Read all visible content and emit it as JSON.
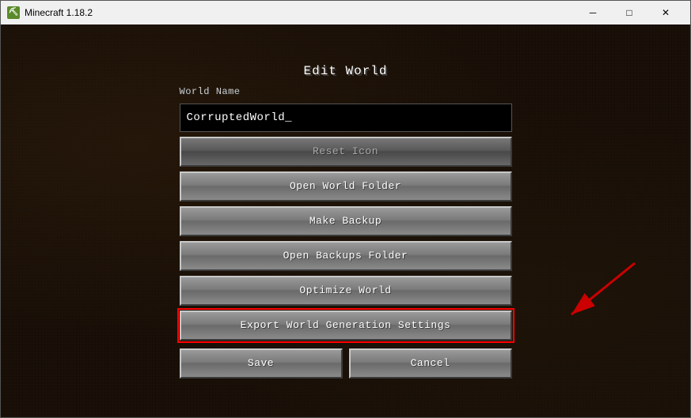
{
  "window": {
    "title": "Minecraft 1.18.2",
    "icon_label": "M",
    "controls": {
      "minimize": "─",
      "maximize": "□",
      "close": "✕"
    }
  },
  "dialog": {
    "title": "Edit World",
    "world_name_label": "World Name",
    "world_name_value": "CorruptedWorld_",
    "world_name_placeholder": "World Name",
    "buttons": {
      "reset_icon": "Reset Icon",
      "open_world_folder": "Open World Folder",
      "make_backup": "Make Backup",
      "open_backups_folder": "Open Backups Folder",
      "optimize_world": "Optimize World",
      "export_world_generation_settings": "Export World Generation Settings",
      "save": "Save",
      "cancel": "Cancel"
    }
  }
}
